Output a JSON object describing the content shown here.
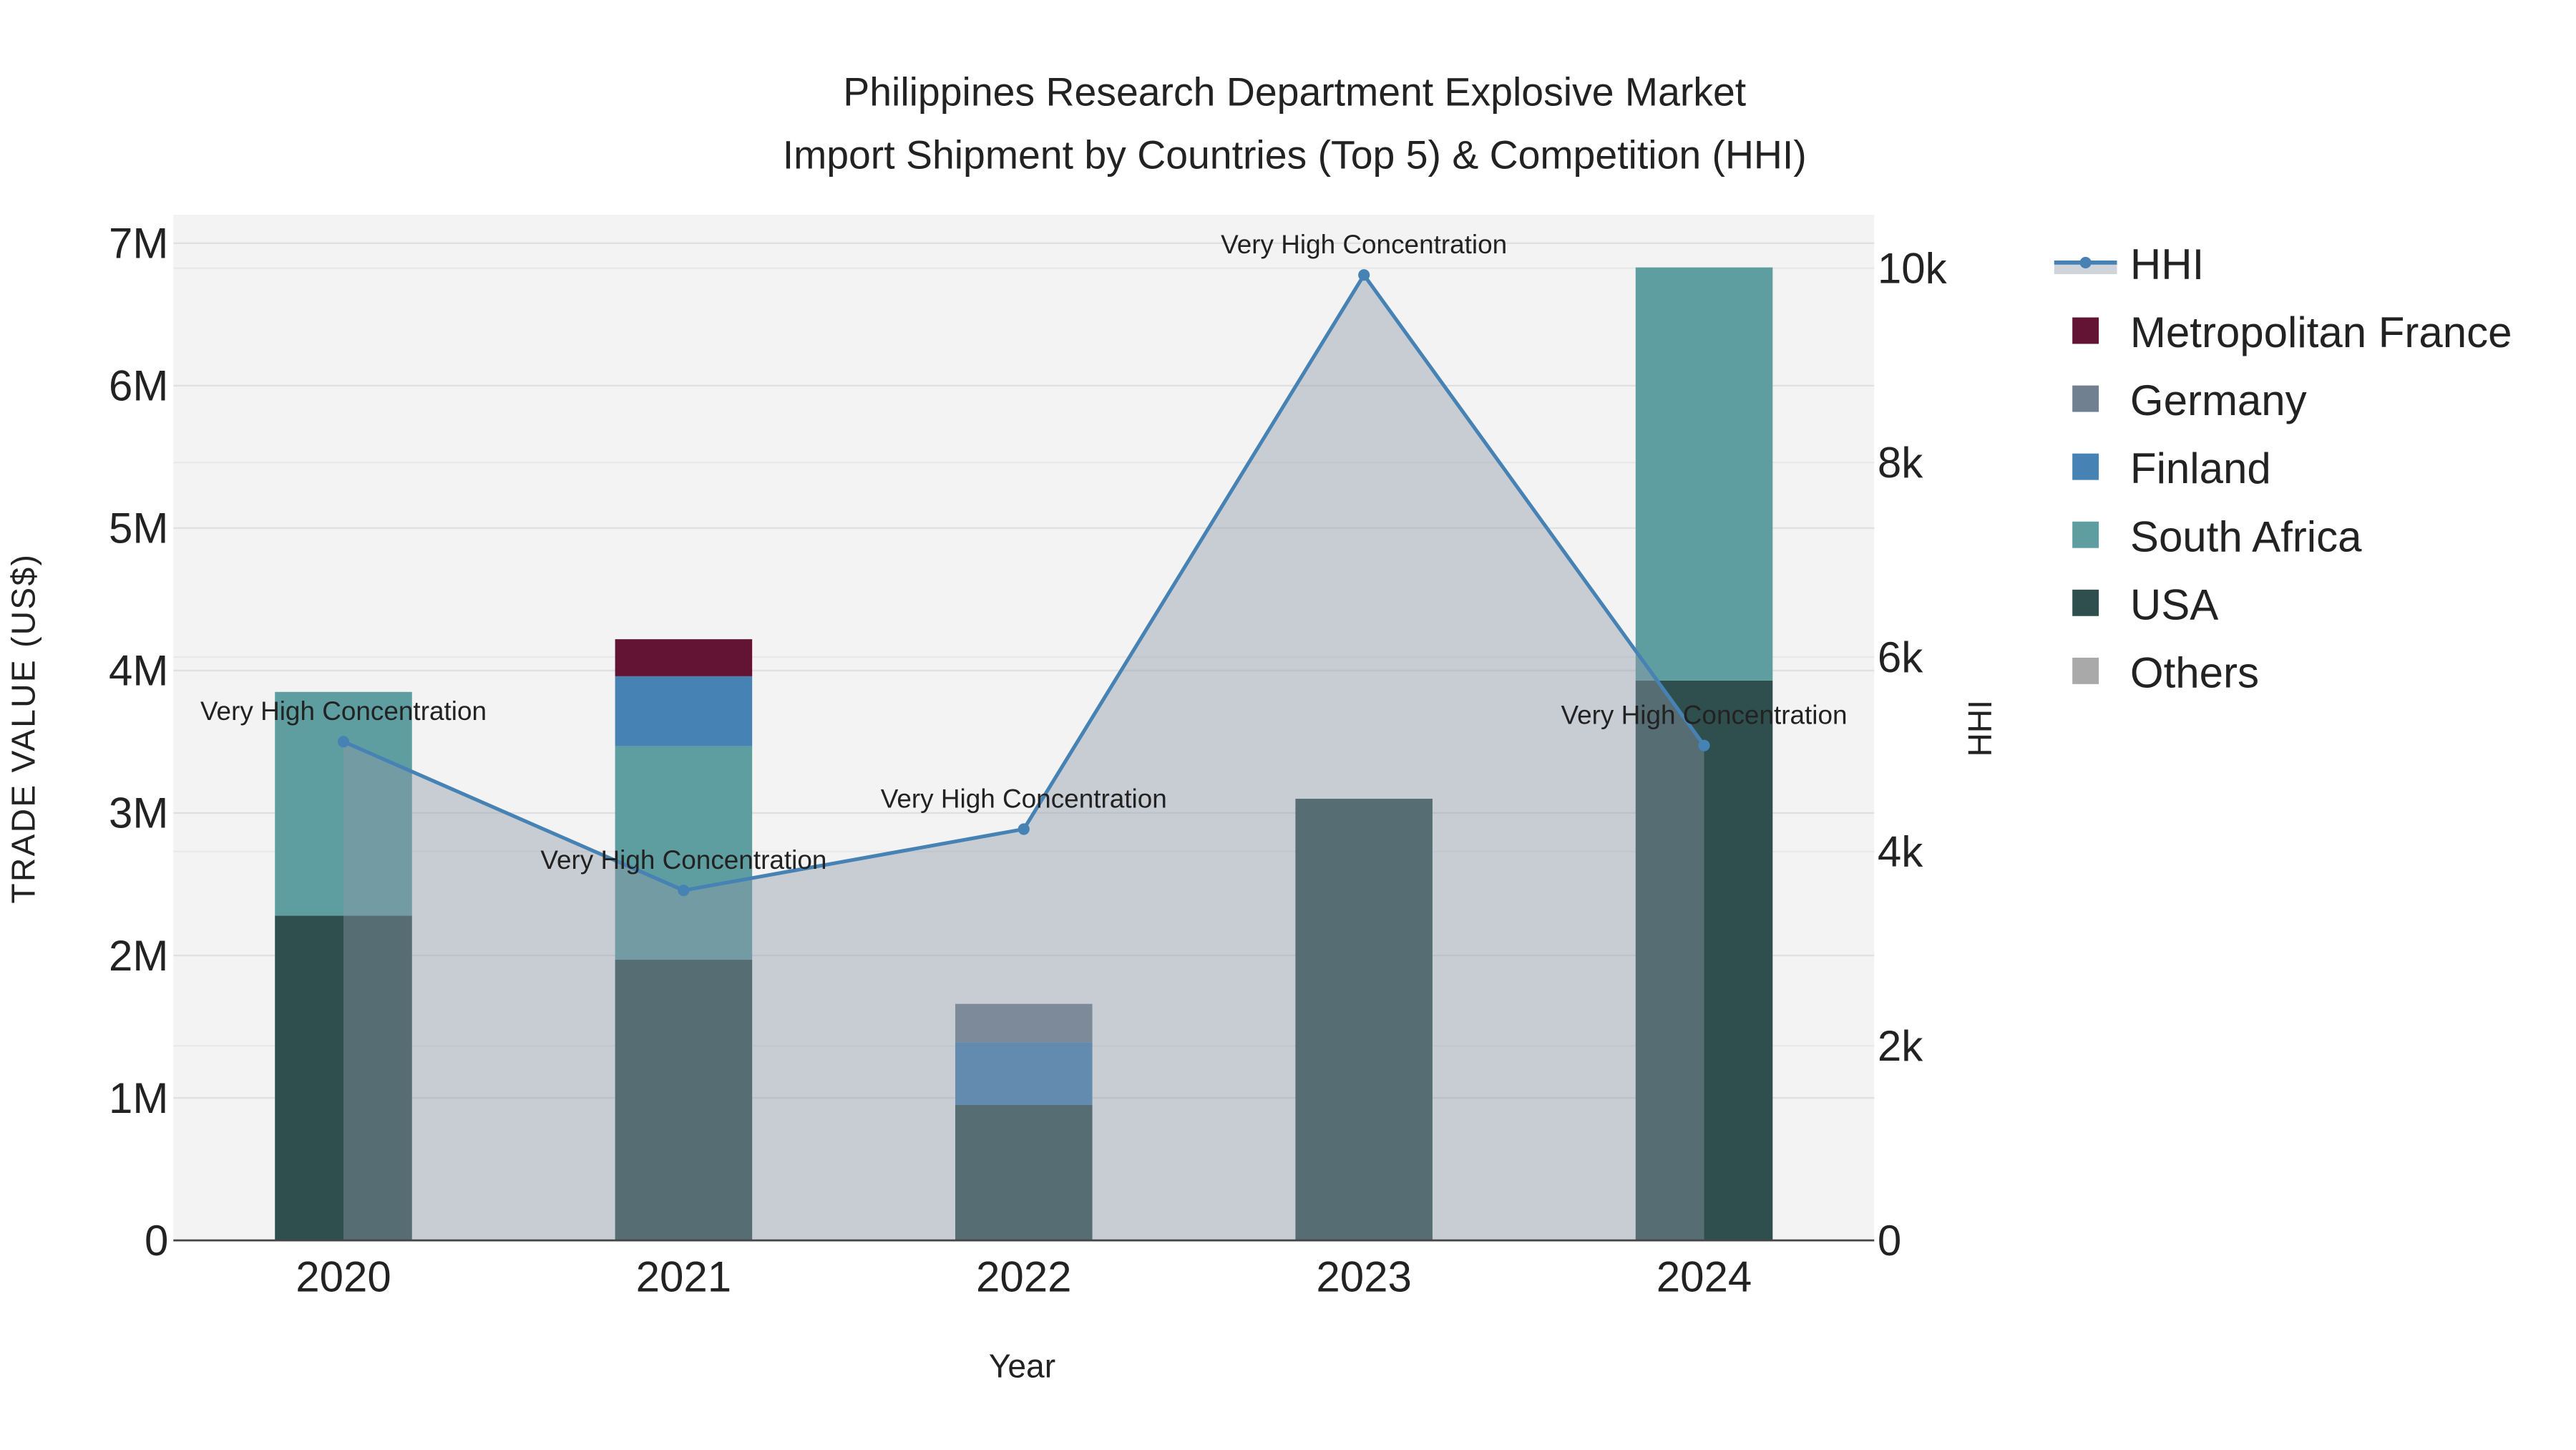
{
  "chart_data": {
    "type": "bar",
    "title_line1": "Philippines Research Department Explosive Market",
    "title_line2": "Import Shipment by Countries (Top 5) & Competition (HHI)",
    "xlabel": "Year",
    "ylabel": "TRADE VALUE (US$)",
    "y2label": "HHI",
    "categories": [
      "2020",
      "2021",
      "2022",
      "2023",
      "2024"
    ],
    "ylim": [
      0,
      7200000
    ],
    "y2lim": [
      0,
      10550
    ],
    "yticks": [
      {
        "v": 0,
        "label": "0"
      },
      {
        "v": 1000000,
        "label": "1M"
      },
      {
        "v": 2000000,
        "label": "2M"
      },
      {
        "v": 3000000,
        "label": "3M"
      },
      {
        "v": 4000000,
        "label": "4M"
      },
      {
        "v": 5000000,
        "label": "5M"
      },
      {
        "v": 6000000,
        "label": "6M"
      },
      {
        "v": 7000000,
        "label": "7M"
      }
    ],
    "y2ticks": [
      {
        "v": 0,
        "label": "0"
      },
      {
        "v": 2000,
        "label": "2k"
      },
      {
        "v": 4000,
        "label": "4k"
      },
      {
        "v": 6000,
        "label": "6k"
      },
      {
        "v": 8000,
        "label": "8k"
      },
      {
        "v": 10000,
        "label": "10k"
      }
    ],
    "stack_series": [
      {
        "name": "USA",
        "color": "#2f4f4f",
        "values": [
          2280000,
          1970000,
          950000,
          3100000,
          3930000
        ]
      },
      {
        "name": "South Africa",
        "color": "#5f9ea0",
        "values": [
          1570000,
          1500000,
          0,
          0,
          2900000
        ]
      },
      {
        "name": "Finland",
        "color": "#4682b4",
        "values": [
          0,
          490000,
          440000,
          0,
          0
        ]
      },
      {
        "name": "Germany",
        "color": "#708090",
        "values": [
          0,
          0,
          270000,
          0,
          0
        ]
      },
      {
        "name": "Metropolitan France",
        "color": "#631434",
        "values": [
          0,
          260000,
          0,
          0,
          0
        ]
      },
      {
        "name": "Others",
        "color": "#a9a9a9",
        "values": [
          0,
          0,
          0,
          0,
          0
        ]
      }
    ],
    "hhi": {
      "name": "HHI",
      "color": "#4682b4",
      "values": [
        5130,
        3600,
        4230,
        9930,
        5090
      ],
      "annotations": [
        "Very High Concentration",
        "Very High Concentration",
        "Very High Concentration",
        "Very High Concentration",
        "Very High Concentration"
      ]
    },
    "legend_order": [
      "HHI",
      "Metropolitan France",
      "Germany",
      "Finland",
      "South Africa",
      "USA",
      "Others"
    ],
    "legend_placement": "right",
    "grid": true
  }
}
